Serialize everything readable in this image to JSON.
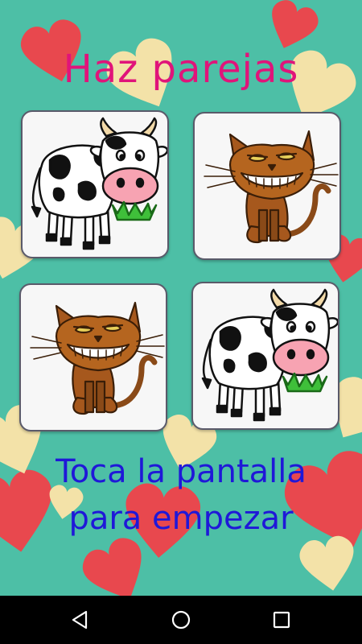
{
  "app": {
    "title": "Haz parejas",
    "instruction_line1": "Toca la pantalla",
    "instruction_line2": "para empezar"
  },
  "cards": [
    {
      "animal": "cow"
    },
    {
      "animal": "cat"
    },
    {
      "animal": "cat"
    },
    {
      "animal": "cow"
    }
  ],
  "colors": {
    "background": "#4dbfa6",
    "title": "#e0147a",
    "instruction": "#1f18d8",
    "heart_red": "#e8484e",
    "heart_yellow": "#f3e2a8"
  },
  "navbar": {
    "buttons": [
      "back-icon",
      "home-icon",
      "recents-icon"
    ]
  }
}
